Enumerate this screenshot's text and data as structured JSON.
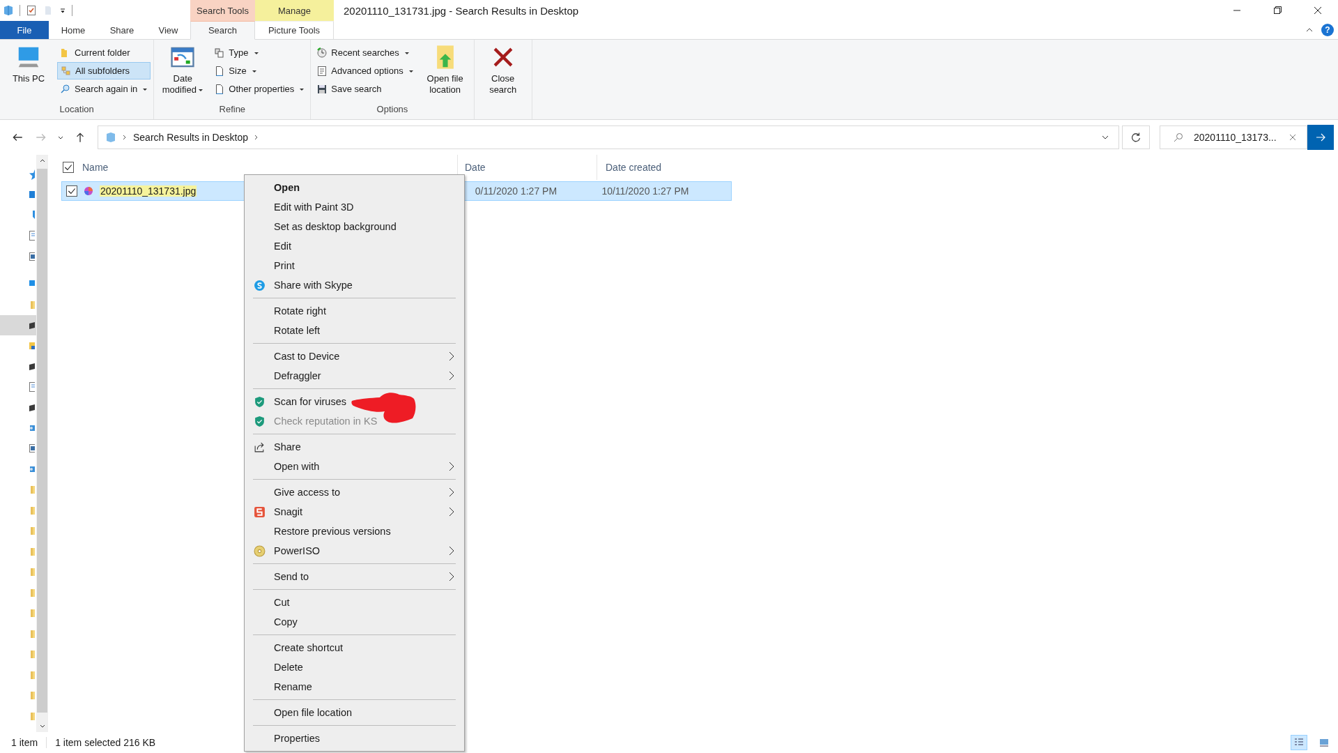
{
  "window": {
    "title": "20201110_131731.jpg - Search Results in Desktop",
    "help": "?"
  },
  "contextual_headers": [
    {
      "label": "Search Tools",
      "color": "#f9d3c3"
    },
    {
      "label": "Manage",
      "color": "#f5f09c"
    }
  ],
  "tabs": [
    {
      "label": "File",
      "selected": false,
      "kind": "file"
    },
    {
      "label": "Home",
      "selected": false,
      "kind": "plain"
    },
    {
      "label": "Share",
      "selected": false,
      "kind": "plain"
    },
    {
      "label": "View",
      "selected": false,
      "kind": "plain"
    },
    {
      "label": "Search",
      "selected": true,
      "kind": "context"
    },
    {
      "label": "Picture Tools",
      "selected": false,
      "kind": "context"
    }
  ],
  "ribbon": {
    "groups": [
      {
        "label": "Location",
        "items": [
          {
            "label": "This PC",
            "kind": "large",
            "dropdown": false,
            "selected": false
          },
          {
            "label": "Current folder",
            "kind": "small",
            "dropdown": false,
            "selected": false
          },
          {
            "label": "All subfolders",
            "kind": "small",
            "dropdown": false,
            "selected": true
          },
          {
            "label": "Search again in",
            "kind": "small",
            "dropdown": true,
            "selected": false
          }
        ]
      },
      {
        "label": "Refine",
        "items": [
          {
            "label": "Date modified",
            "kind": "large",
            "dropdown": true,
            "selected": false
          },
          {
            "label": "Type",
            "kind": "small",
            "dropdown": true,
            "selected": false
          },
          {
            "label": "Size",
            "kind": "small",
            "dropdown": true,
            "selected": false
          },
          {
            "label": "Other properties",
            "kind": "small",
            "dropdown": true,
            "selected": false
          }
        ]
      },
      {
        "label": "Options",
        "items": [
          {
            "label": "Recent searches",
            "kind": "small",
            "dropdown": true,
            "selected": false
          },
          {
            "label": "Advanced options",
            "kind": "small",
            "dropdown": true,
            "selected": false
          },
          {
            "label": "Save search",
            "kind": "small",
            "dropdown": false,
            "selected": false
          },
          {
            "label": "Open file location",
            "kind": "large",
            "dropdown": false,
            "selected": false
          }
        ]
      },
      {
        "items": [
          {
            "label": "Close search",
            "kind": "large",
            "dropdown": false,
            "selected": false
          }
        ]
      }
    ]
  },
  "address_bar": {
    "path": [
      "Search Results in Desktop"
    ]
  },
  "search_field": {
    "value": "20201110_13173..."
  },
  "nav_pane": {
    "items": [
      {
        "selected": false
      },
      {
        "selected": false
      },
      {
        "selected": false
      },
      {
        "selected": false
      },
      {
        "selected": false
      },
      {
        "selected": false
      },
      {
        "selected": false
      },
      {
        "selected": true
      },
      {
        "selected": false
      },
      {
        "selected": false
      },
      {
        "selected": false
      },
      {
        "selected": false
      },
      {
        "selected": false
      },
      {
        "selected": false
      },
      {
        "selected": false
      },
      {
        "selected": false
      },
      {
        "selected": false
      },
      {
        "selected": false
      },
      {
        "selected": false
      },
      {
        "selected": false
      },
      {
        "selected": false
      },
      {
        "selected": false
      },
      {
        "selected": false
      },
      {
        "selected": false
      },
      {
        "selected": false
      },
      {
        "selected": false
      },
      {
        "selected": false
      }
    ]
  },
  "table": {
    "select_all": {
      "checked": true
    },
    "columns": [
      "Name",
      "Date",
      "Date created"
    ],
    "rows": [
      {
        "name": "20201110_131731.jpg",
        "date": "0/11/2020 1:27 PM",
        "date_created": "10/11/2020 1:27 PM",
        "checked": true,
        "selected": true
      }
    ]
  },
  "context_menu": {
    "groups": [
      [
        {
          "label": "Open",
          "submenu": false,
          "disabled": false,
          "default": true
        },
        {
          "label": "Edit with Paint 3D",
          "submenu": false,
          "disabled": false,
          "default": false
        },
        {
          "label": "Set as desktop background",
          "submenu": false,
          "disabled": false,
          "default": false
        },
        {
          "label": "Edit",
          "submenu": false,
          "disabled": false,
          "default": false
        },
        {
          "label": "Print",
          "submenu": false,
          "disabled": false,
          "default": false
        },
        {
          "label": "Share with Skype",
          "submenu": false,
          "disabled": false,
          "default": false
        }
      ],
      [
        {
          "label": "Rotate right",
          "submenu": false,
          "disabled": false,
          "default": false
        },
        {
          "label": "Rotate left",
          "submenu": false,
          "disabled": false,
          "default": false
        }
      ],
      [
        {
          "label": "Cast to Device",
          "submenu": true,
          "disabled": false,
          "default": false
        },
        {
          "label": "Defraggler",
          "submenu": true,
          "disabled": false,
          "default": false
        }
      ],
      [
        {
          "label": "Scan for viruses",
          "submenu": false,
          "disabled": false,
          "default": false
        },
        {
          "label": "Check reputation in KS",
          "submenu": false,
          "disabled": true,
          "default": false
        }
      ],
      [
        {
          "label": "Share",
          "submenu": false,
          "disabled": false,
          "default": false
        },
        {
          "label": "Open with",
          "submenu": true,
          "disabled": false,
          "default": false
        }
      ],
      [
        {
          "label": "Give access to",
          "submenu": true,
          "disabled": false,
          "default": false
        },
        {
          "label": "Snagit",
          "submenu": true,
          "disabled": false,
          "default": false
        },
        {
          "label": "Restore previous versions",
          "submenu": false,
          "disabled": false,
          "default": false
        },
        {
          "label": "PowerISO",
          "submenu": true,
          "disabled": false,
          "default": false
        }
      ],
      [
        {
          "label": "Send to",
          "submenu": true,
          "disabled": false,
          "default": false
        }
      ],
      [
        {
          "label": "Cut",
          "submenu": false,
          "disabled": false,
          "default": false
        },
        {
          "label": "Copy",
          "submenu": false,
          "disabled": false,
          "default": false
        }
      ],
      [
        {
          "label": "Create shortcut",
          "submenu": false,
          "disabled": false,
          "default": false
        },
        {
          "label": "Delete",
          "submenu": false,
          "disabled": false,
          "default": false
        },
        {
          "label": "Rename",
          "submenu": false,
          "disabled": false,
          "default": false
        }
      ],
      [
        {
          "label": "Open file location",
          "submenu": false,
          "disabled": false,
          "default": false
        }
      ],
      [
        {
          "label": "Properties",
          "submenu": false,
          "disabled": false,
          "default": false
        }
      ]
    ]
  },
  "status_bar": {
    "count": "1 item",
    "selection": "1 item selected  216 KB",
    "views": [
      {
        "selected": true
      },
      {
        "selected": false
      }
    ]
  }
}
